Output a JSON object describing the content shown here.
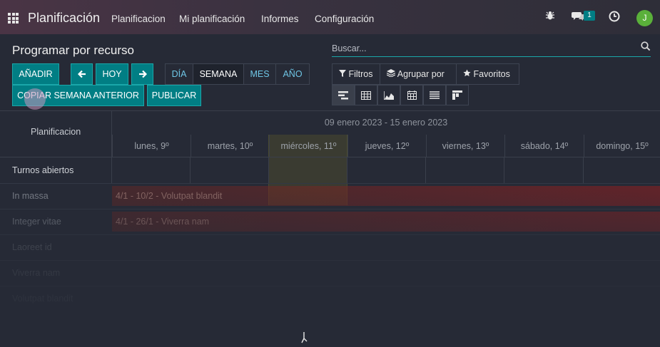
{
  "topbar": {
    "brand": "Planificación",
    "menu": [
      "Planificacion",
      "Mi planificación",
      "Informes",
      "Configuración"
    ],
    "messages_badge": "1",
    "avatar_initial": "J"
  },
  "control": {
    "title": "Programar por recurso",
    "search_placeholder": "Buscar...",
    "add_label": "AÑADIR",
    "today_label": "HOY",
    "scales": [
      "DÍA",
      "SEMANA",
      "MES",
      "AÑO"
    ],
    "active_scale": "SEMANA",
    "copy_label": "COPIAR SEMANA ANTERIOR",
    "publish_label": "PUBLICAR",
    "filters_label": "Filtros",
    "groupby_label": "Agrupar por",
    "favorites_label": "Favoritos",
    "view_icons": [
      "gantt-view-icon",
      "pivot-view-icon",
      "graph-view-icon",
      "calendar-view-icon",
      "list-view-icon",
      "kanban-view-icon"
    ]
  },
  "gantt": {
    "left_header": "Planificacion",
    "range_label": "09 enero 2023 - 15 enero 2023",
    "days": [
      "lunes, 9º",
      "martes, 10º",
      "miércoles, 11º",
      "jueves, 12º",
      "viernes, 13º",
      "sábado, 14º",
      "domingo, 15º"
    ],
    "rows": [
      {
        "label": "Turnos abiertos",
        "pill": ""
      },
      {
        "label": "In massa",
        "pill": "4/1 - 10/2 - Volutpat blandit"
      },
      {
        "label": "Integer vitae",
        "pill": "4/1 - 26/1 - Viverra nam"
      },
      {
        "label": "Laoreet id",
        "pill": ""
      },
      {
        "label": "Viverra nam",
        "pill": ""
      },
      {
        "label": "Volutpat blandit",
        "pill": ""
      }
    ]
  },
  "colors": {
    "accent": "#017E84",
    "accent_border": "#1AA7A9",
    "avatar": "#5AB03A",
    "background": "#262A36"
  }
}
